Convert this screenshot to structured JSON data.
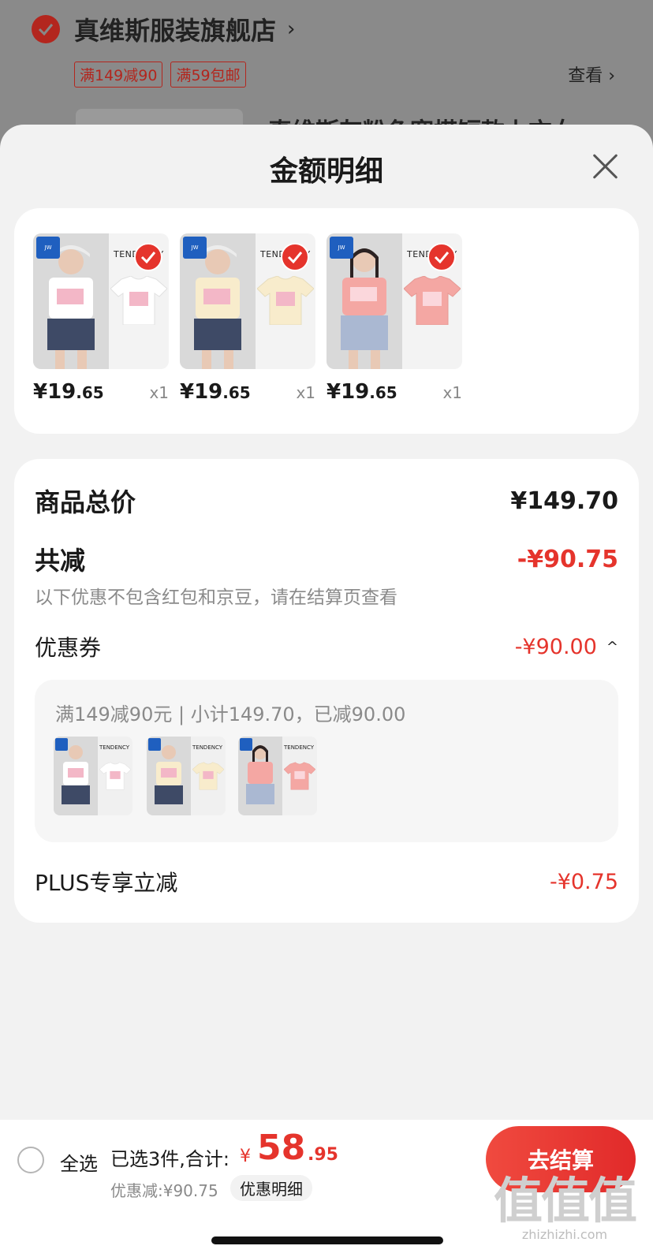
{
  "background": {
    "store_name": "真维斯服装旗舰店",
    "store_arrow": "›",
    "tags": [
      "满149减90",
      "满59包邮"
    ],
    "view_label": "查看 ›",
    "product_title_partial": "真维斯灰粉色宽搭短款上衣女"
  },
  "sheet": {
    "title": "金额明细"
  },
  "products": [
    {
      "price_int": "¥19",
      "price_dec": ".65",
      "qty": "x1",
      "color": "#ffffff",
      "brand_text": "TENDENCY"
    },
    {
      "price_int": "¥19",
      "price_dec": ".65",
      "qty": "x1",
      "color": "#f8eccc",
      "brand_text": "TENDENCY"
    },
    {
      "price_int": "¥19",
      "price_dec": ".65",
      "qty": "x1",
      "color": "#f4a7a3",
      "brand_text": "TENDENCY"
    }
  ],
  "summary": {
    "total_label": "商品总价",
    "total_value": "¥149.70",
    "reduce_label": "共减",
    "reduce_value": "-¥90.75",
    "reduce_note": "以下优惠不包含红包和京豆，请在结算页查看",
    "coupon_label": "优惠券",
    "coupon_value": "-¥90.00",
    "coupon_caret": "^",
    "coupon_detail": "满149减90元 | 小计149.70，已减90.00",
    "plus_label": "PLUS专享立减",
    "plus_value": "-¥0.75"
  },
  "bottom": {
    "select_all": "全选",
    "selected_text": "已选3件,合计:",
    "total_currency": "¥",
    "total_int": "58",
    "total_dec": ".95",
    "discount_text": "优惠减:¥90.75",
    "detail_button": "优惠明细",
    "checkout": "去结算"
  },
  "watermark": {
    "glyphs": "值值值",
    "url": "zhizhizhi.com"
  },
  "colors": {
    "accent_red": "#e5342c",
    "brand_blue": "#1f5fbf"
  }
}
